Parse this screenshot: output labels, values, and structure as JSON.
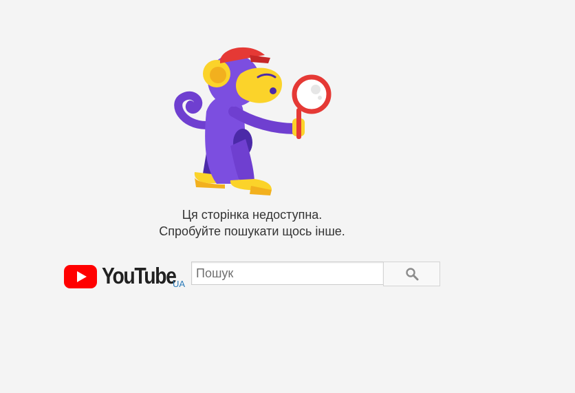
{
  "illustration": {
    "icon": "monkey-with-magnifying-glass-icon"
  },
  "message": {
    "line1": "Ця сторінка недоступна.",
    "line2": "Спробуйте пошукати щось інше."
  },
  "logo": {
    "text": "YouTube",
    "country_code": "UA",
    "icon": "youtube-play-icon"
  },
  "search": {
    "placeholder": "Пошук",
    "value": "",
    "button_icon": "search-icon"
  },
  "colors": {
    "background": "#f4f4f4",
    "youtube_red": "#ff0000",
    "monkey_purple": "#6f3fd0",
    "monkey_yellow": "#fbd32a",
    "hat_red": "#e53935",
    "country_code_blue": "#2a7ab8"
  }
}
